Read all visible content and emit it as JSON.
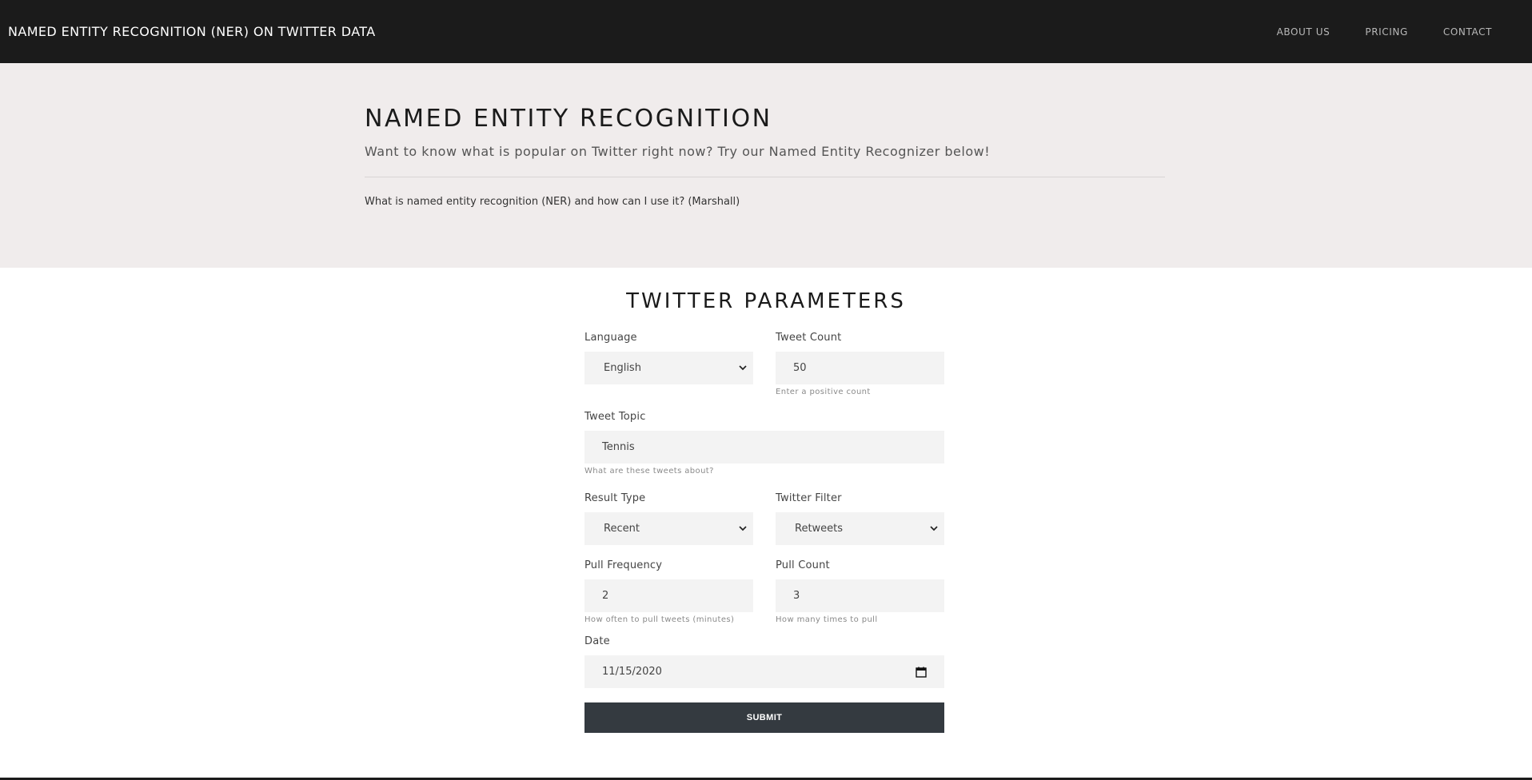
{
  "nav": {
    "brand": "NAMED ENTITY RECOGNITION (NER) ON TWITTER DATA",
    "links": [
      "ABOUT US",
      "PRICING",
      "CONTACT"
    ]
  },
  "hero": {
    "title": "NAMED ENTITY RECOGNITION",
    "subtitle": "Want to know what is popular on Twitter right now? Try our Named Entity Recognizer below!",
    "info_link": "What is named entity recognition (NER) and how can I use it? (Marshall)"
  },
  "form": {
    "title": "TWITTER PARAMETERS",
    "language": {
      "label": "Language",
      "value": "English"
    },
    "tweet_count": {
      "label": "Tweet Count",
      "value": "50",
      "help": "Enter a positive count"
    },
    "tweet_topic": {
      "label": "Tweet Topic",
      "value": "Tennis",
      "help": "What are these tweets about?"
    },
    "result_type": {
      "label": "Result Type",
      "value": "Recent"
    },
    "twitter_filter": {
      "label": "Twitter Filter",
      "value": "Retweets"
    },
    "pull_frequency": {
      "label": "Pull Frequency",
      "value": "2",
      "help": "How often to pull tweets (minutes)"
    },
    "pull_count": {
      "label": "Pull Count",
      "value": "3",
      "help": "How many times to pull"
    },
    "date": {
      "label": "Date",
      "value": "11/15/2020"
    },
    "submit": "SUBMIT"
  },
  "icons": {
    "select_arrow": "chevron-down-icon",
    "date_picker": "calendar-icon"
  }
}
